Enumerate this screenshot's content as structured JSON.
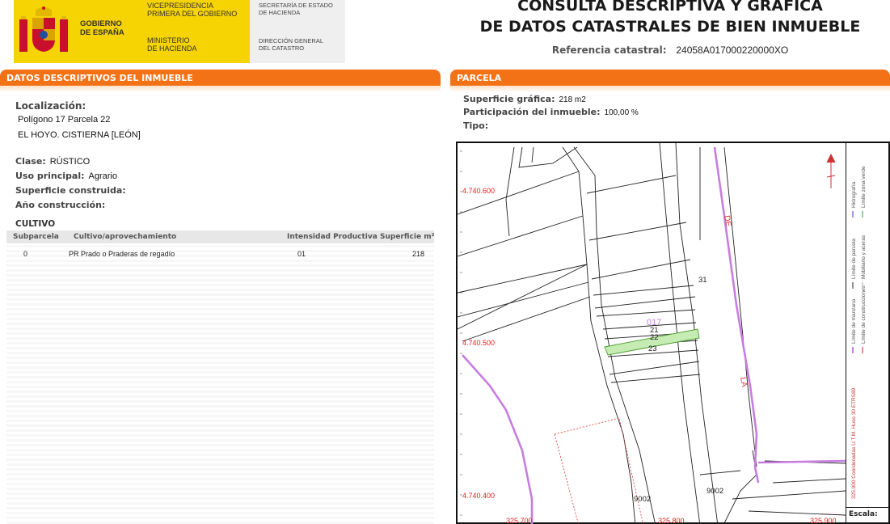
{
  "header": {
    "gov_name": "GOBIERNO\nDE ESPAÑA",
    "vicepresidencia": "VICEPRESIDENCIA\nPRIMERA DEL GOBIERNO",
    "ministerio": "MINISTERIO\nDE HACIENDA",
    "secretaria": "SECRETARÍA DE ESTADO\nDE HACIENDA",
    "direccion": "DIRECCIÓN GENERAL\nDEL CATASTRO",
    "title": "CONSULTA DESCRIPTIVA Y GRÁFICA\nDE DATOS CATASTRALES DE BIEN INMUEBLE",
    "ref_label": "Referencia catastral:",
    "ref_value": "24058A017000220000XO"
  },
  "left": {
    "section_title": "DATOS DESCRIPTIVOS DEL INMUEBLE",
    "localizacion_label": "Localización:",
    "localizacion_line1": "Polígono 17 Parcela 22",
    "localizacion_line2": "EL HOYO. CISTIERNA [LEÓN]",
    "clase_label": "Clase:",
    "clase_value": "RÚSTICO",
    "uso_label": "Uso principal:",
    "uso_value": "Agrario",
    "superficie_label": "Superficie construida:",
    "anio_label": "Año construcción:",
    "cultivo_title": "CULTIVO",
    "table": {
      "headers": [
        "Subparcela",
        "Cultivo/aprovechamiento",
        "Intensidad Productiva",
        "Superficie m²"
      ],
      "rows": [
        [
          "0",
          "PR Prado o Praderas de regadío",
          "01",
          "218"
        ]
      ]
    }
  },
  "right": {
    "section_title": "PARCELA",
    "superficie_grafica_label": "Superficie gráfica:",
    "superficie_grafica_value": "218 m2",
    "participacion_label": "Participación del inmueble:",
    "participacion_value": "100,00 %",
    "tipo_label": "Tipo:",
    "map": {
      "y_coords": [
        "4.740.600",
        "4.740.500",
        "4.740.400"
      ],
      "x_coords": [
        "325.700",
        "325.800",
        "325.900"
      ],
      "parcel_labels": [
        "017",
        "21",
        "22",
        "23",
        "31",
        "9002",
        "9002"
      ],
      "road_letters": [
        "DE",
        "LA"
      ],
      "legend": [
        "Límite de manzana",
        "Límite de construcciones",
        "Límite de parcela",
        "Mobiliario y aceras",
        "Hidrografía",
        "Límite zona verde"
      ],
      "coord_note": "325.900 Coordenadas U.T.M. Huso 30 ETRS89",
      "scale_label": "Escala:"
    },
    "colors": {
      "accent": "#f47216",
      "road": "#c77de0",
      "coords": "#e02020",
      "highlight": "#c6ecb4"
    }
  }
}
